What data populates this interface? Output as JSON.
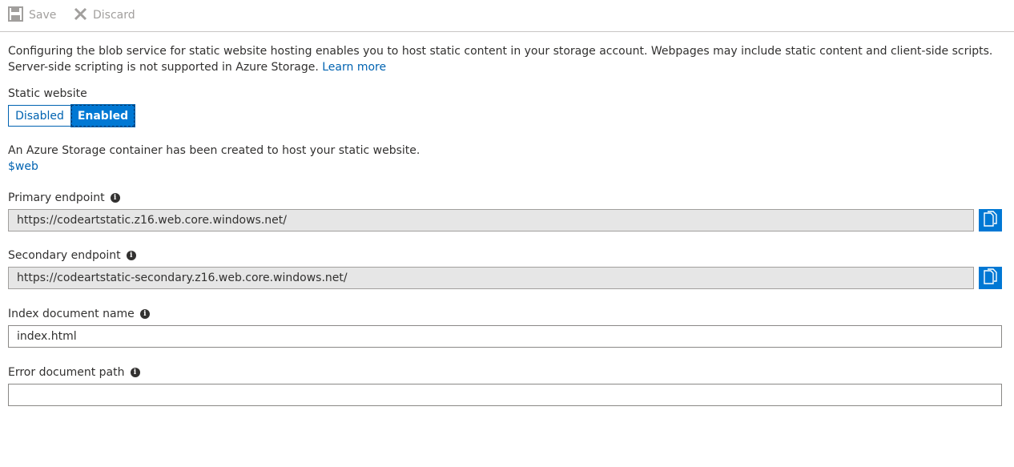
{
  "toolbar": {
    "save_label": "Save",
    "discard_label": "Discard",
    "save_icon": "save-icon",
    "discard_icon": "close-icon"
  },
  "description": {
    "text": "Configuring the blob service for static website hosting enables you to host static content in your storage account. Webpages may include static content and client-side scripts. Server-side scripting is not supported in Azure Storage.",
    "link": "Learn more"
  },
  "static_website": {
    "label": "Static website",
    "options": [
      "Disabled",
      "Enabled"
    ],
    "selected": "Enabled"
  },
  "container_note": {
    "text": "An Azure Storage container has been created to host your static website.",
    "link": "$web"
  },
  "primary_endpoint": {
    "label": "Primary endpoint",
    "value": "https://codeartstatic.z16.web.core.windows.net/"
  },
  "secondary_endpoint": {
    "label": "Secondary endpoint",
    "value": "https://codeartstatic-secondary.z16.web.core.windows.net/"
  },
  "index_document": {
    "label": "Index document name",
    "value": "index.html"
  },
  "error_document": {
    "label": "Error document path",
    "value": ""
  },
  "colors": {
    "accent": "#0078d4",
    "link": "#0063b1",
    "readonly_bg": "#e6e6e6"
  }
}
